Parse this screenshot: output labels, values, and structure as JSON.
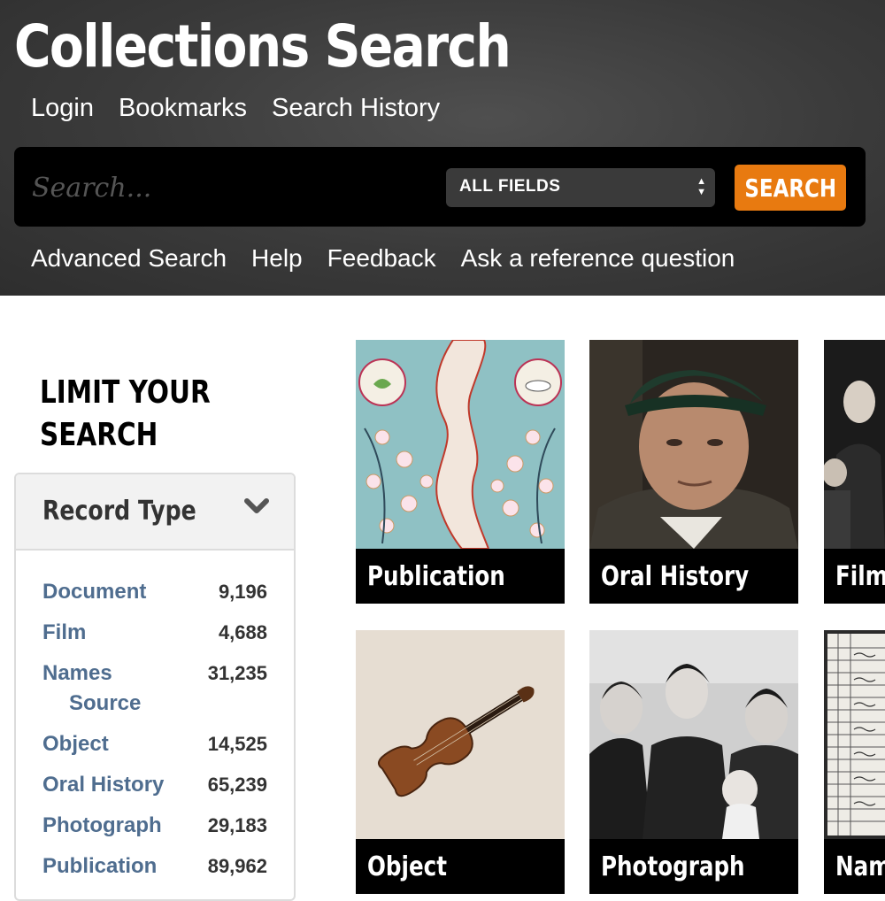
{
  "header": {
    "title": "Collections Search",
    "top_nav": [
      "Login",
      "Bookmarks",
      "Search History"
    ],
    "search": {
      "placeholder": "Search...",
      "field_select": "ALL FIELDS",
      "button": "SEARCH"
    },
    "sub_nav": [
      "Advanced Search",
      "Help",
      "Feedback",
      "Ask a reference question"
    ]
  },
  "sidebar": {
    "title": "LIMIT YOUR SEARCH",
    "facet": {
      "title": "Record Type",
      "items": [
        {
          "label": "Document",
          "count": "9,196"
        },
        {
          "label": "Film",
          "count": "4,688"
        },
        {
          "label": "Names",
          "label_line2": "Source",
          "count": "31,235"
        },
        {
          "label": "Object",
          "count": "14,525"
        },
        {
          "label": "Oral History",
          "count": "65,239"
        },
        {
          "label": "Photograph",
          "count": "29,183"
        },
        {
          "label": "Publication",
          "count": "89,962"
        }
      ]
    }
  },
  "tiles": [
    {
      "label": "Publication"
    },
    {
      "label": "Oral History"
    },
    {
      "label": "Film"
    },
    {
      "label": "Object"
    },
    {
      "label": "Photograph"
    },
    {
      "label": "Name"
    }
  ],
  "colors": {
    "accent": "#e87a10",
    "link": "#4f6d8f",
    "header_bg": "#3a3a3a"
  }
}
